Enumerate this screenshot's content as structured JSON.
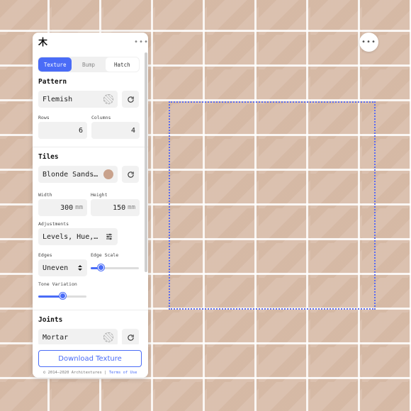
{
  "canvas": {
    "menu_label": "•••"
  },
  "panel": {
    "logo_glyph": "⽊",
    "more_label": "•••",
    "tabs": [
      {
        "label": "Texture",
        "active": true
      },
      {
        "label": "Bump",
        "active": false
      },
      {
        "label": "Hatch",
        "active": false
      }
    ],
    "pattern": {
      "title": "Pattern",
      "type_value": "Flemish",
      "rows_label": "Rows",
      "rows_value": "6",
      "columns_label": "Columns",
      "columns_value": "4"
    },
    "tiles": {
      "title": "Tiles",
      "material_value": "Blonde Sands…",
      "swatch_color": "#c9a28c",
      "width_label": "Width",
      "width_value": "300",
      "width_unit": "mm",
      "height_label": "Height",
      "height_value": "150",
      "height_unit": "mm",
      "adjustments_label": "Adjustments",
      "adjustments_value": "Levels, Hue,…",
      "edges_label": "Edges",
      "edges_value": "Uneven",
      "edge_scale_label": "Edge Scale",
      "edge_scale_fraction": 0.2,
      "tone_variation_label": "Tone Variation",
      "tone_variation_fraction": 0.5
    },
    "joints": {
      "title": "Joints",
      "material_value": "Mortar"
    },
    "download_label": "Download Texture",
    "footer_text": "© 2014–2020 Architextures | ",
    "footer_link": "Terms of Use"
  },
  "colors": {
    "accent": "#4a6cf7",
    "selection_border": "#5b6cf0"
  }
}
